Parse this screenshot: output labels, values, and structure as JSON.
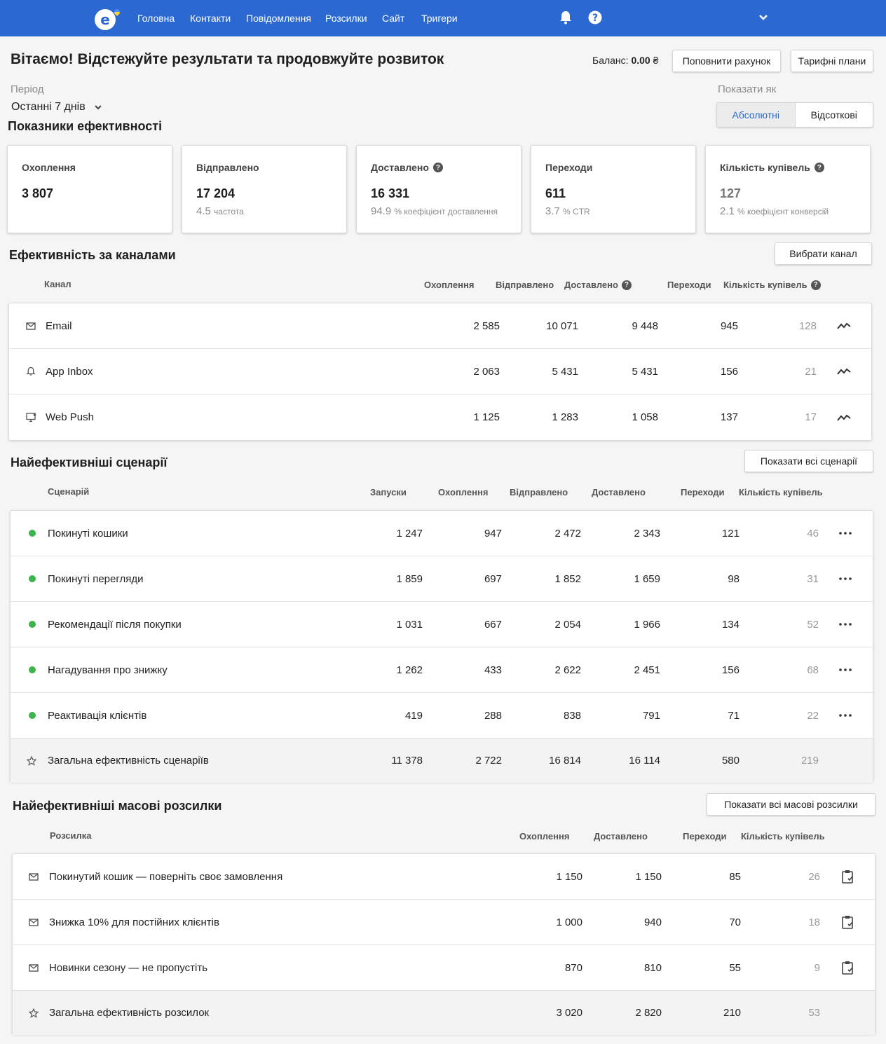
{
  "nav": {
    "items": [
      "Головна",
      "Контакти",
      "Повідомлення",
      "Розсилки",
      "Сайт",
      "Тригери"
    ]
  },
  "header": {
    "title": "Вітаємо! Відстежуйте результати та продовжуйте розвиток",
    "balance_label": "Баланс:",
    "balance_value": "0.00",
    "currency": "₴",
    "topup_button": "Поповнити рахунок",
    "plans_button": "Тарифні плани"
  },
  "period": {
    "label": "Період",
    "value": "Останні 7 днів"
  },
  "show_as": {
    "label": "Показати як",
    "options": [
      "Абсолютні",
      "Відсоткові"
    ],
    "selected": "Абсолютні"
  },
  "kpi": {
    "title": "Показники ефективності",
    "cards": [
      {
        "title": "Охоплення",
        "value": "3 807",
        "sub_value": "",
        "sub_label": ""
      },
      {
        "title": "Відправлено",
        "value": "17 204",
        "sub_value": "4.5",
        "sub_label": "частота"
      },
      {
        "title": "Доставлено",
        "value": "16 331",
        "sub_value": "94.9",
        "sub_label": "% коефіцієнт доставлення"
      },
      {
        "title": "Переходи",
        "value": "611",
        "sub_value": "3.7",
        "sub_label": "% CTR"
      },
      {
        "title": "Кількість купівель",
        "value": "127",
        "sub_value": "2.1",
        "sub_label": "% коефіцієнт конверсій"
      }
    ]
  },
  "channels": {
    "title": "Ефективність за каналами",
    "button": "Вибрати канал",
    "columns": [
      "Канал",
      "Охоплення",
      "Відправлено",
      "Доставлено",
      "Переходи",
      "Кількість купівель"
    ],
    "rows": [
      {
        "icon": "mail-icon",
        "name": "Email",
        "reach": "2 585",
        "sent": "10 071",
        "delivered": "9 448",
        "clicks": "945",
        "purchases": "128"
      },
      {
        "icon": "bell-icon",
        "name": "App Inbox",
        "reach": "2 063",
        "sent": "5 431",
        "delivered": "5 431",
        "clicks": "156",
        "purchases": "21"
      },
      {
        "icon": "monitor-icon",
        "name": "Web Push",
        "reach": "1 125",
        "sent": "1 283",
        "delivered": "1 058",
        "clicks": "137",
        "purchases": "17"
      }
    ]
  },
  "scenarios": {
    "title": "Найефективніші сценарії",
    "button": "Показати всі сценарії",
    "columns": [
      "Сценарій",
      "Запуски",
      "Охоплення",
      "Відправлено",
      "Доставлено",
      "Переходи",
      "Кількість купівель"
    ],
    "rows": [
      {
        "name": "Покинуті кошики",
        "runs": "1 247",
        "reach": "947",
        "sent": "2 472",
        "delivered": "2 343",
        "clicks": "121",
        "purchases": "46"
      },
      {
        "name": "Покинуті перегляди",
        "runs": "1 859",
        "reach": "697",
        "sent": "1 852",
        "delivered": "1 659",
        "clicks": "98",
        "purchases": "31"
      },
      {
        "name": "Рекомендації після покупки",
        "runs": "1 031",
        "reach": "667",
        "sent": "2 054",
        "delivered": "1 966",
        "clicks": "134",
        "purchases": "52"
      },
      {
        "name": "Нагадування про знижку",
        "runs": "1 262",
        "reach": "433",
        "sent": "2 622",
        "delivered": "2 451",
        "clicks": "156",
        "purchases": "68"
      },
      {
        "name": "Реактивація клієнтів",
        "runs": "419",
        "reach": "288",
        "sent": "838",
        "delivered": "791",
        "clicks": "71",
        "purchases": "22"
      }
    ],
    "total": {
      "name": "Загальна ефективність сценаріїв",
      "runs": "11 378",
      "reach": "2 722",
      "sent": "16 814",
      "delivered": "16 114",
      "clicks": "580",
      "purchases": "219"
    }
  },
  "campaigns": {
    "title": "Найефективніші масові розсилки",
    "button": "Показати всі масові розсилки",
    "columns": [
      "Розсилка",
      "Охоплення",
      "Доставлено",
      "Переходи",
      "Кількість купівель"
    ],
    "rows": [
      {
        "name": "Покинутий кошик — поверніть своє замовлення",
        "reach": "1 150",
        "delivered": "1 150",
        "clicks": "85",
        "purchases": "26"
      },
      {
        "name": "Знижка 10% для постійних клієнтів",
        "reach": "1 000",
        "delivered": "940",
        "clicks": "70",
        "purchases": "18"
      },
      {
        "name": "Новинки сезону — не пропустіть",
        "reach": "870",
        "delivered": "810",
        "clicks": "55",
        "purchases": "9"
      }
    ],
    "total": {
      "name": "Загальна ефективність розсилок",
      "reach": "3 020",
      "delivered": "2 820",
      "clicks": "210",
      "purchases": "53"
    }
  },
  "colors": {
    "nav_bg": "#2b68d1",
    "accent": "#2b68d1",
    "active_dot": "#3cb44b"
  }
}
